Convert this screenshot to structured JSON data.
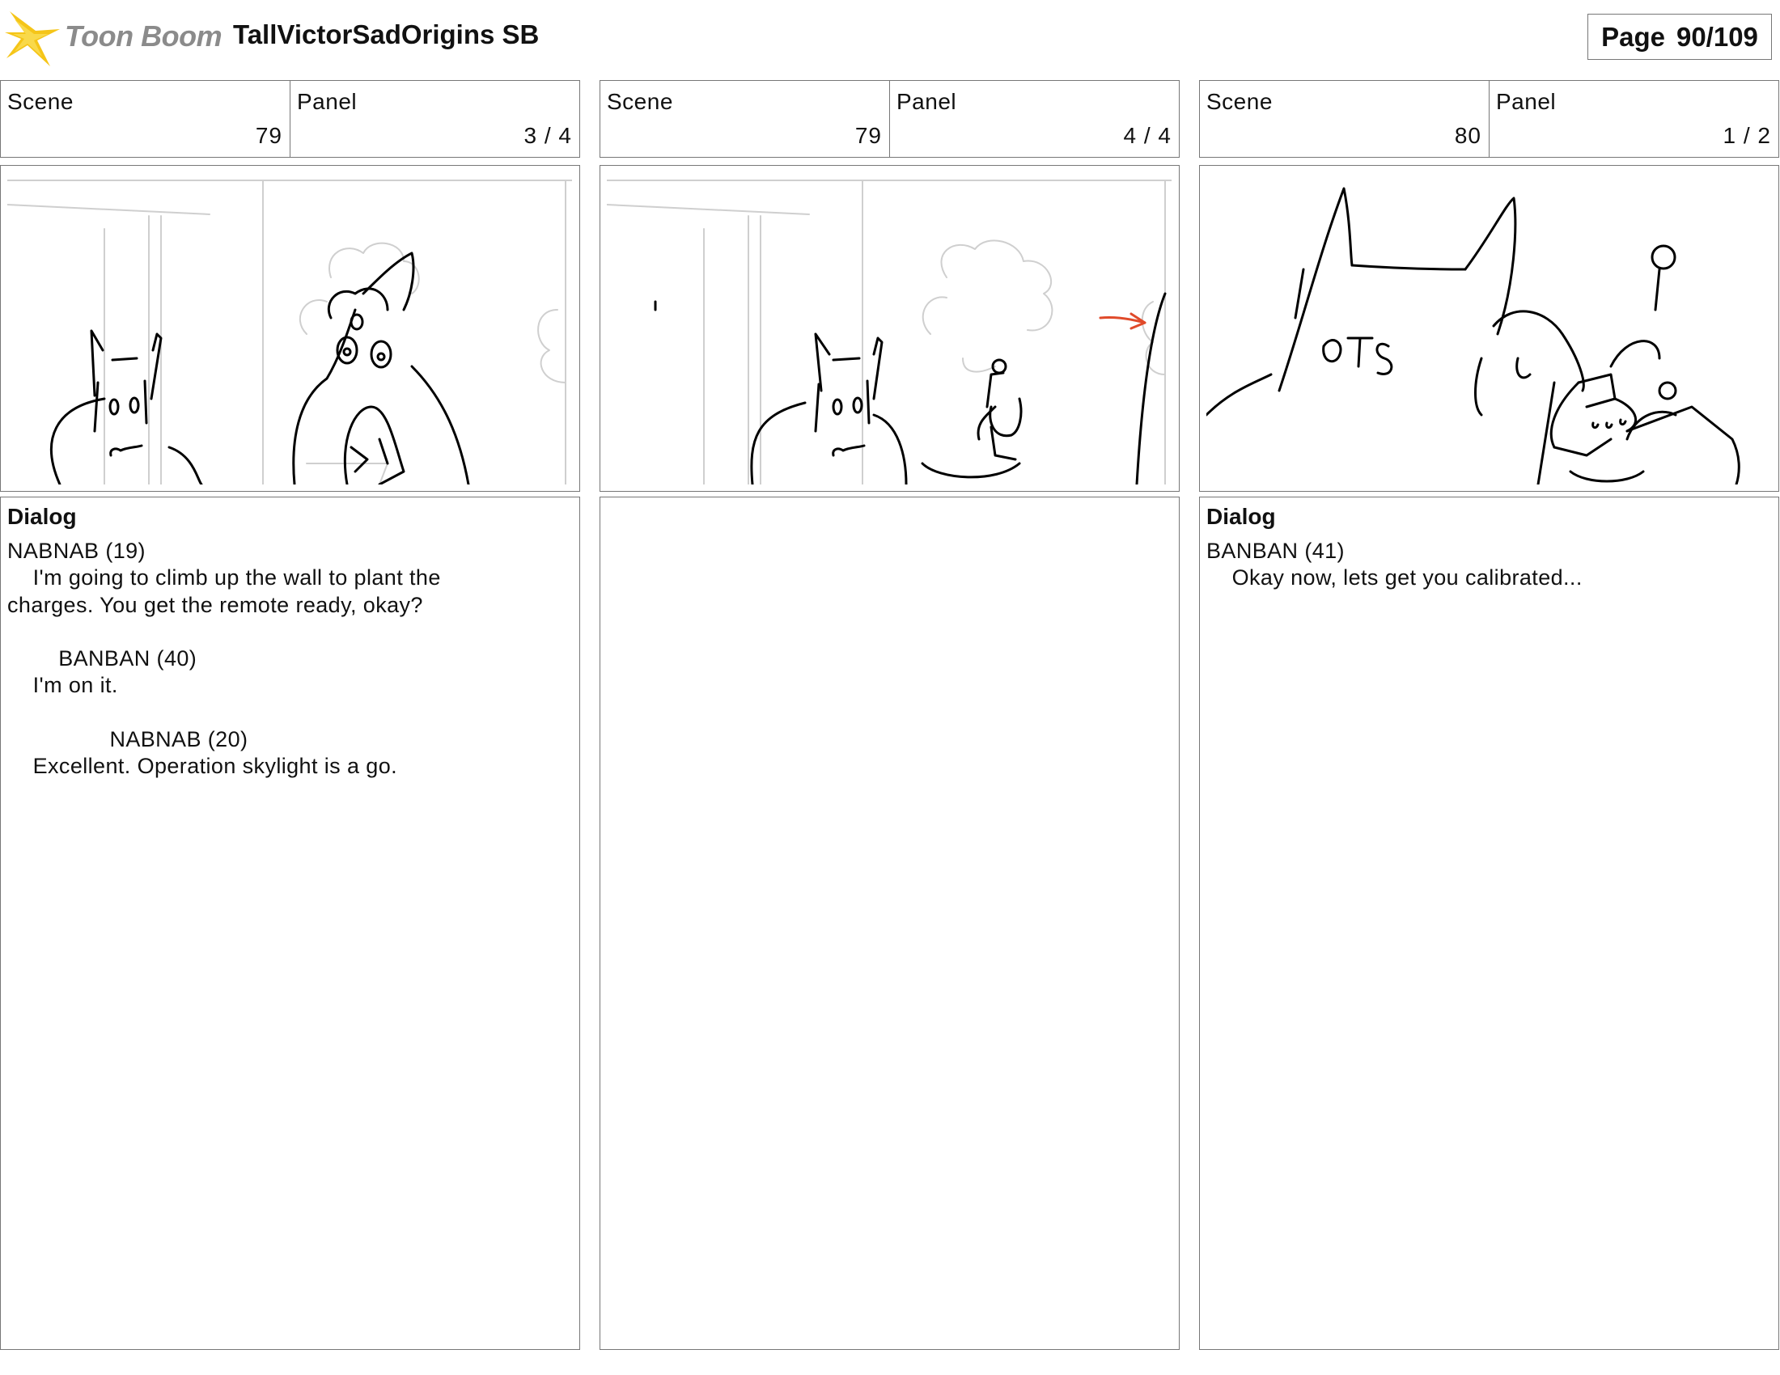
{
  "header": {
    "logo_text": "Toon Boom",
    "title": "TallVictorSadOrigins SB",
    "page_label": "Page",
    "page_value": "90/109"
  },
  "panels": [
    {
      "scene_label": "Scene",
      "scene": "79",
      "panel_label": "Panel",
      "panel": "3 / 4",
      "dialog_heading": "Dialog",
      "dialog": "NABNAB (19)\n    I'm going to climb up the wall to plant the\ncharges. You get the remote ready, okay?\n\n        BANBAN (40)\n    I'm on it.\n\n                NABNAB (20)\n    Excellent. Operation skylight is a go."
    },
    {
      "scene_label": "Scene",
      "scene": "79",
      "panel_label": "Panel",
      "panel": "4 / 4",
      "dialog_heading": "",
      "dialog": ""
    },
    {
      "scene_label": "Scene",
      "scene": "80",
      "panel_label": "Panel",
      "panel": "1 / 2",
      "dialog_heading": "Dialog",
      "dialog": "BANBAN (41)\n    Okay now, lets get you calibrated...",
      "sketch_note": "OTS"
    }
  ],
  "colors": {
    "logo_yellow": "#f5c518",
    "border": "#777777",
    "annotation_red": "#e04a2a",
    "sketch_grey": "#c8c8c8"
  }
}
